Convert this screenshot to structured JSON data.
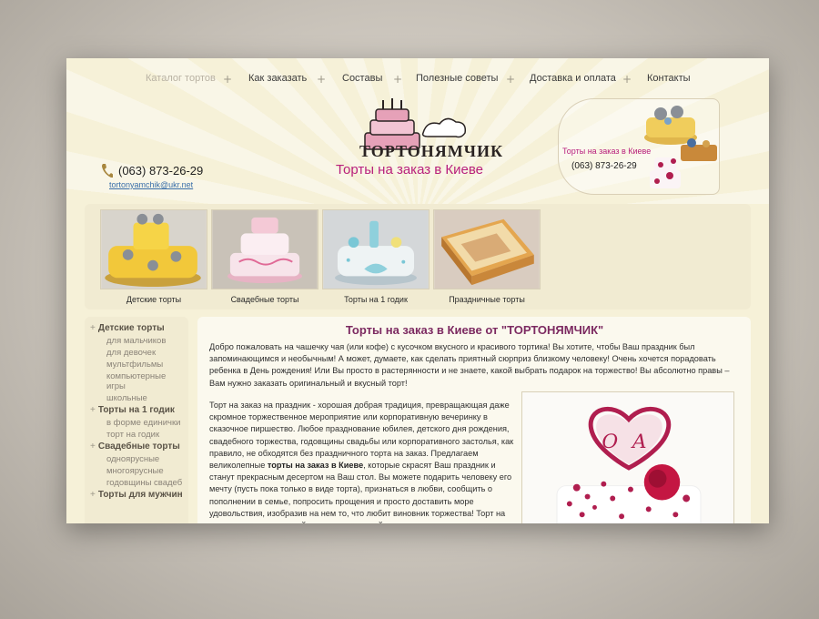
{
  "nav": {
    "items": [
      "Каталог тортов",
      "Как заказать",
      "Составы",
      "Полезные советы",
      "Доставка и оплата",
      "Контакты"
    ]
  },
  "header": {
    "logo_text": "ТОРТОНЯМЧИК",
    "tagline": "Торты на заказ в Киеве",
    "phone": "(063) 873-26-29",
    "email": "tortonyamchik@ukr.net"
  },
  "promo": {
    "title": "Торты на заказ в Киеве",
    "phone": "(063) 873-26-29"
  },
  "categories": [
    {
      "label": "Детские торты",
      "icon": "children-cake-thumbnail"
    },
    {
      "label": "Свадебные торты",
      "icon": "wedding-cake-thumbnail"
    },
    {
      "label": "Торты на 1 годик",
      "icon": "first-birthday-cake-thumbnail"
    },
    {
      "label": "Праздничные торты",
      "icon": "holiday-cake-thumbnail"
    }
  ],
  "sidebar": {
    "groups": [
      {
        "title": "Детские торты",
        "items": [
          "для мальчиков",
          "для девочек",
          "мультфильмы",
          "компьютерные игры",
          "школьные"
        ]
      },
      {
        "title": "Торты на 1 годик",
        "items": [
          "в форме единички",
          "торт на годик"
        ]
      },
      {
        "title": "Свадебные торты",
        "items": [
          "одноярусные",
          "многоярусные",
          "годовщины свадеб"
        ]
      },
      {
        "title": "Торты для мужчин",
        "items": []
      }
    ]
  },
  "content": {
    "title": "Торты на заказ в Киеве от \"ТОРТОНЯМЧИК\"",
    "para1": "Добро пожаловать на чашечку чая (или кофе) с кусочком вкусного и красивого тортика! Вы хотите, чтобы Ваш праздник был запоминающимся и необычным! А может, думаете, как сделать приятный сюрприз близкому человеку! Очень хочется порадовать ребенка в День рождения! Или Вы просто в растерянности и не знаете, какой выбрать подарок на торжество! Вы абсолютно правы – Вам нужно заказать оригинальный и вкусный торт!",
    "para2_a": "Торт на заказ на праздник - хорошая добрая традиция, превращающая даже скромное торжественное мероприятие или корпоративную вечеринку в сказочное пиршество. Любое празднование юбилея, детского дня рождения, свадебного торжества, годовщины свадьбы или корпоративного застолья, как правило, не обходятся без праздничного торта на заказ. Предлагаем великолепные ",
    "para2_bold": "торты на заказ в Киеве",
    "para2_b": ", которые скрасят Ваш праздник и станут прекрасным десертом на Ваш стол. Вы можете подарить человеку его мечту (пусть пока только в виде торта), признаться в любви, сообщить о пополнении в семье, попросить прощения и просто доставить море удовольствия, изобразив на нем то, что любит виновник торжества! Торт на заказ с поздравительной надписью, сладкой"
  },
  "colors": {
    "accent": "#b8207d",
    "title": "#7c2a61",
    "page_bg": "#f6f1d8"
  }
}
